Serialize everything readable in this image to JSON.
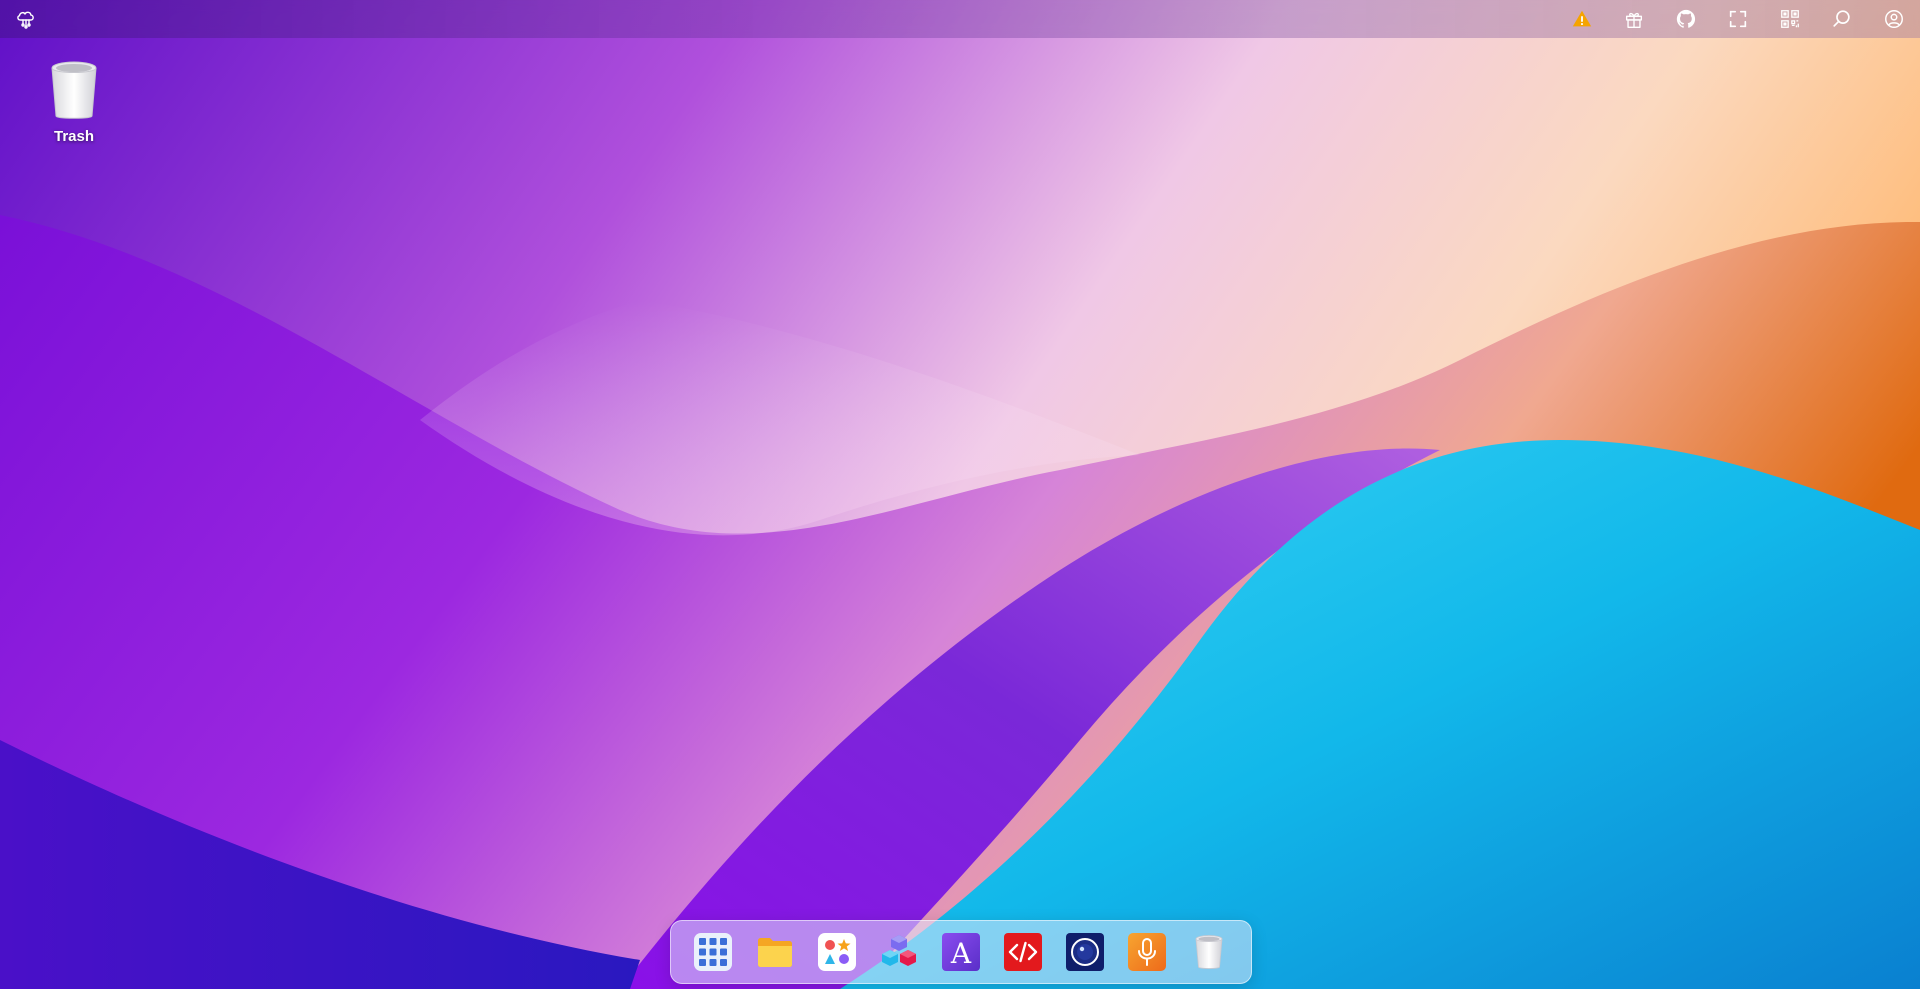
{
  "desktop": {
    "icons": [
      {
        "label": "Trash",
        "icon": "trash-bin-icon"
      }
    ]
  },
  "topbar": {
    "logo_icon": "cloud-network-logo-icon",
    "buttons": [
      {
        "name": "warning-button",
        "icon": "warning-triangle-icon",
        "color": "#f5a400"
      },
      {
        "name": "gift-button",
        "icon": "gift-icon"
      },
      {
        "name": "github-button",
        "icon": "github-icon"
      },
      {
        "name": "fullscreen-button",
        "icon": "fullscreen-icon"
      },
      {
        "name": "qr-code-button",
        "icon": "qr-code-icon"
      },
      {
        "name": "search-button",
        "icon": "search-icon"
      },
      {
        "name": "account-button",
        "icon": "user-circle-icon"
      }
    ]
  },
  "dock": {
    "items": [
      {
        "name": "launcher",
        "icon": "app-grid-icon",
        "color": "#3b6fd8"
      },
      {
        "name": "file-manager",
        "icon": "folder-icon",
        "color": "#f7c331"
      },
      {
        "name": "app-store",
        "icon": "apps-icon",
        "color": "#ffffff"
      },
      {
        "name": "3d-blocks",
        "icon": "cubes-icon",
        "color": "#2fc3f0"
      },
      {
        "name": "font-app",
        "icon": "letter-a-icon",
        "color": "#6a3fd6"
      },
      {
        "name": "code-editor",
        "icon": "code-icon",
        "color": "#e3191d"
      },
      {
        "name": "camera",
        "icon": "camera-lens-icon",
        "color": "#1a2b7a"
      },
      {
        "name": "voice-recorder",
        "icon": "microphone-icon",
        "color": "#f28c1e"
      },
      {
        "name": "trash",
        "icon": "trash-bin-icon",
        "color": "#e6e6e6"
      }
    ]
  },
  "colors": {
    "wallpaper_purple": "#7a10e0",
    "wallpaper_pink": "#f0c8e8",
    "wallpaper_orange": "#ee7a1a",
    "wallpaper_cyan": "#1ec6ee",
    "wallpaper_blue": "#0c88d8"
  }
}
